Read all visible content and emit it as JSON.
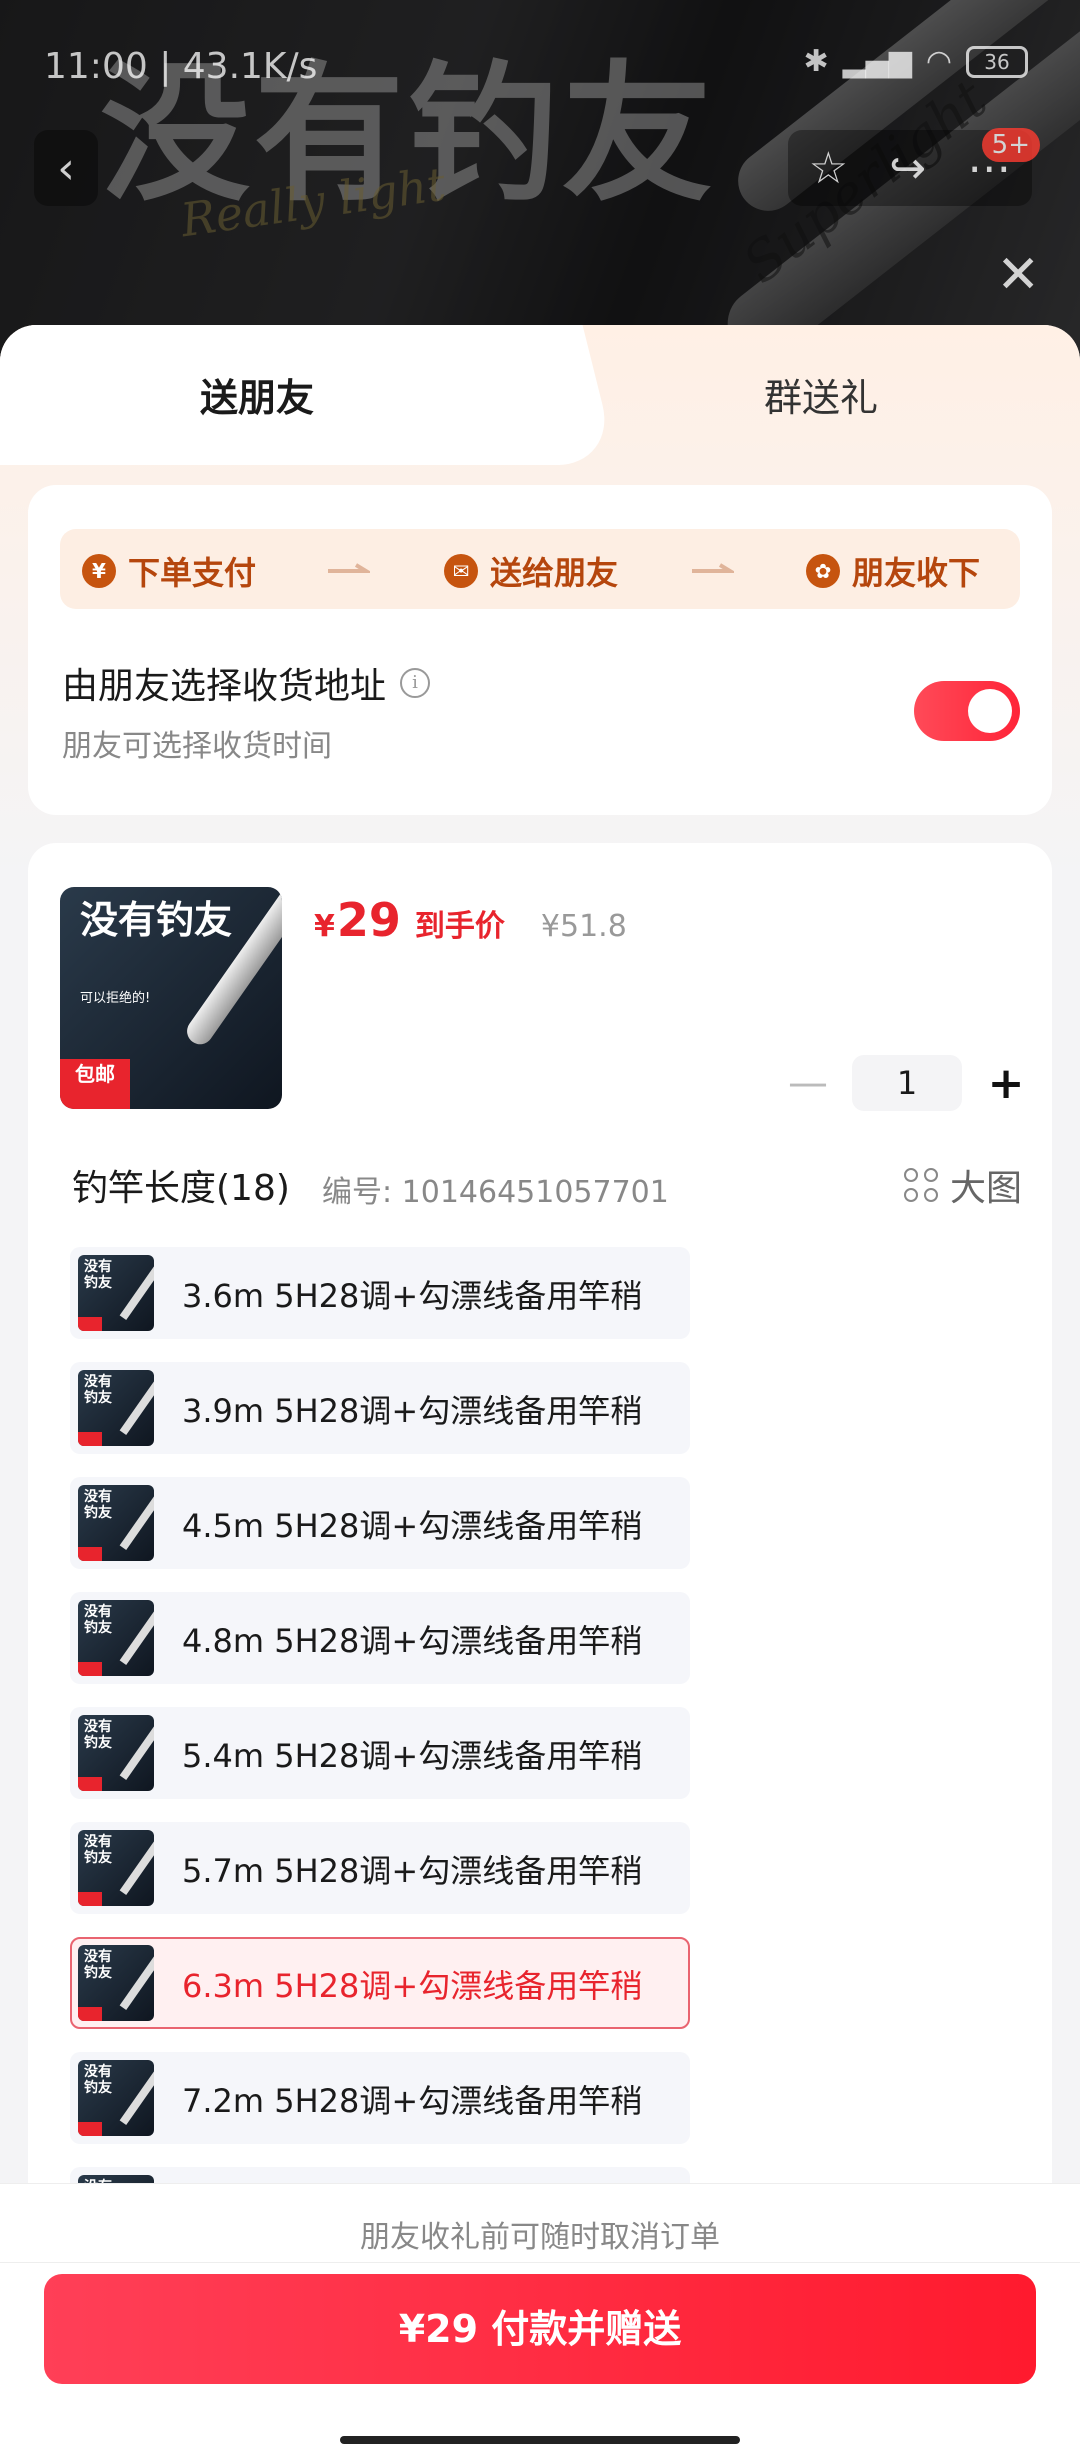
{
  "status_bar": {
    "time": "11:00 | 43.1K/s",
    "battery": "36"
  },
  "backdrop": {
    "big_text": "没有钓友",
    "script_text": "Really light",
    "rod_text": "Superlight",
    "badge": "5+"
  },
  "tabs": {
    "send_friend": "送朋友",
    "group_gift": "群送礼"
  },
  "steps": [
    {
      "icon": "¥",
      "label": "下单支付"
    },
    {
      "icon": "✉",
      "label": "送给朋友"
    },
    {
      "icon": "✿",
      "label": "朋友收下"
    }
  ],
  "gift_option": {
    "title": "由朋友选择收货地址",
    "subtitle": "朋友可选择收货时间",
    "enabled": true
  },
  "product": {
    "thumb_text": "没有钓友",
    "thumb_sub": "可以拒绝的!",
    "thumb_tag": "包邮",
    "price_symbol": "¥",
    "price": "29",
    "price_label": "到手价",
    "original_price": "¥51.8",
    "quantity": "1"
  },
  "spec": {
    "title": "钓竿长度(18)",
    "code": "编号: 10146451057701",
    "view_label": "大图",
    "options": [
      {
        "label": "3.6m 5H28调+勾漂线备用竿稍",
        "selected": false
      },
      {
        "label": "3.9m 5H28调+勾漂线备用竿稍",
        "selected": false
      },
      {
        "label": "4.5m 5H28调+勾漂线备用竿稍",
        "selected": false
      },
      {
        "label": "4.8m 5H28调+勾漂线备用竿稍",
        "selected": false
      },
      {
        "label": "5.4m 5H28调+勾漂线备用竿稍",
        "selected": false
      },
      {
        "label": "5.7m 5H28调+勾漂线备用竿稍",
        "selected": false
      },
      {
        "label": "6.3m 5H28调+勾漂线备用竿稍",
        "selected": true
      },
      {
        "label": "7.2m 5H28调+勾漂线备用竿稍",
        "selected": false
      }
    ]
  },
  "footer": {
    "note": "朋友收礼前可随时取消订单",
    "pay_button": "¥29 付款并赠送"
  },
  "colors": {
    "accent": "#e8242d",
    "step_text": "#b5460d",
    "toggle": "#ff2438"
  }
}
